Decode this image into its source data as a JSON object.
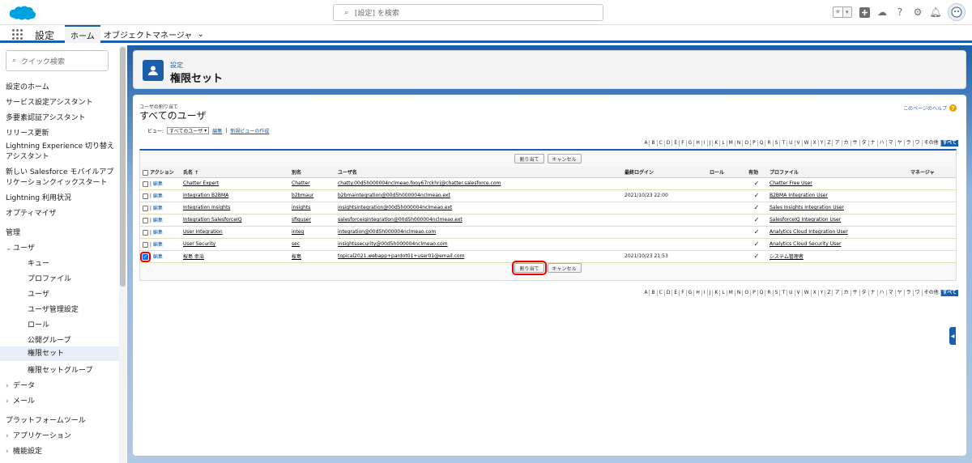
{
  "search": {
    "placeholder": "[設定] を検索"
  },
  "nav": {
    "app_name": "設定",
    "tabs": [
      {
        "label": "ホーム"
      },
      {
        "label": "オブジェクトマネージャ"
      }
    ]
  },
  "sidebar": {
    "quick_search": "クイック検索",
    "items": [
      {
        "label": "設定のホーム"
      },
      {
        "label": "サービス設定アシスタント"
      },
      {
        "label": "多要素認証アシスタント"
      },
      {
        "label": "リリース更新"
      },
      {
        "label": "Lightning Experience 切り替えアシスタント"
      },
      {
        "label": "新しい Salesforce モバイルアプリケーションクイックスタート"
      },
      {
        "label": "Lightning 利用状況"
      },
      {
        "label": "オプティマイザ"
      },
      {
        "label": "管理"
      },
      {
        "label": "ユーザ"
      },
      {
        "label": "キュー"
      },
      {
        "label": "プロファイル"
      },
      {
        "label": "ユーザ"
      },
      {
        "label": "ユーザ管理設定"
      },
      {
        "label": "ロール"
      },
      {
        "label": "公開グループ"
      },
      {
        "label": "権限セット"
      },
      {
        "label": "権限セットグループ"
      },
      {
        "label": "データ"
      },
      {
        "label": "メール"
      },
      {
        "label": "プラットフォームツール"
      },
      {
        "label": "アプリケーション"
      },
      {
        "label": "機能設定"
      }
    ]
  },
  "header": {
    "subtitle": "設定",
    "title": "権限セット"
  },
  "content": {
    "subtitle": "ユーザの割り当て",
    "title": "すべてのユーザ",
    "help": "このページのヘルプ",
    "view_label": "ビュー:",
    "view_value": "すべてのユーザ",
    "edit_link": "編集",
    "create_view_link": "新規ビューの作成",
    "alphabet": [
      "A",
      "B",
      "C",
      "D",
      "E",
      "F",
      "G",
      "H",
      "I",
      "J",
      "K",
      "L",
      "M",
      "N",
      "O",
      "P",
      "Q",
      "R",
      "S",
      "T",
      "U",
      "V",
      "W",
      "X",
      "Y",
      "Z",
      "ア",
      "カ",
      "サ",
      "タ",
      "ナ",
      "ハ",
      "マ",
      "ヤ",
      "ラ",
      "ワ",
      "その他",
      "すべて"
    ],
    "assign_button": "割り当て",
    "cancel_button": "キャンセル"
  },
  "table": {
    "headers": [
      "アクション",
      "氏名 ↑",
      "別名",
      "ユーザ名",
      "最終ログイン",
      "ロール",
      "有効",
      "プロファイル",
      "マネージャ"
    ],
    "rows": [
      {
        "action": "編集",
        "name": "Chatter Expert",
        "alias": "Chatter",
        "username": "chatty.00d5h000004nclmeao.fooy67rckhrj@chatter.salesforce.com",
        "last_login": "",
        "role": "",
        "active": "✓",
        "profile": "Chatter Free User",
        "manager": "",
        "checked": false
      },
      {
        "action": "編集",
        "name": "Integration B2BMA",
        "alias": "b2bmaur",
        "username": "b2bmaintegration@00d5h000004nclmeao.ext",
        "last_login": "2021/10/23 22:00",
        "role": "",
        "active": "✓",
        "profile": "B2BMA Integration User",
        "manager": "",
        "checked": false
      },
      {
        "action": "編集",
        "name": "Integration Insights",
        "alias": "insights",
        "username": "insightsintegration@00d5h000004nclmeao.ext",
        "last_login": "",
        "role": "",
        "active": "✓",
        "profile": "Sales Insights Integration User",
        "manager": "",
        "checked": false
      },
      {
        "action": "編集",
        "name": "Integration SalesforceIQ",
        "alias": "sfiquser",
        "username": "salesforceiqintegration@00d5h000004nclmeao.ext",
        "last_login": "",
        "role": "",
        "active": "✓",
        "profile": "SalesforceIQ Integration User",
        "manager": "",
        "checked": false
      },
      {
        "action": "編集",
        "name": "User Integration",
        "alias": "integ",
        "username": "integration@00d5h000004nclmeao.com",
        "last_login": "",
        "role": "",
        "active": "✓",
        "profile": "Analytics Cloud Integration User",
        "manager": "",
        "checked": false
      },
      {
        "action": "編集",
        "name": "User Security",
        "alias": "sec",
        "username": "insightssecurity@00d5h000004nclmeao.com",
        "last_login": "",
        "role": "",
        "active": "✓",
        "profile": "Analytics Cloud Security User",
        "manager": "",
        "checked": false
      },
      {
        "action": "編集",
        "name": "桜島 幸治",
        "alias": "桜島",
        "username": "topical2021.webapp+pardot01+user01@email.com",
        "last_login": "2021/10/23 21:53",
        "role": "",
        "active": "✓",
        "profile": "システム管理者",
        "manager": "",
        "checked": true
      }
    ]
  },
  "colors": {
    "brand": "#1b5faa",
    "highlight": "#e00000"
  }
}
